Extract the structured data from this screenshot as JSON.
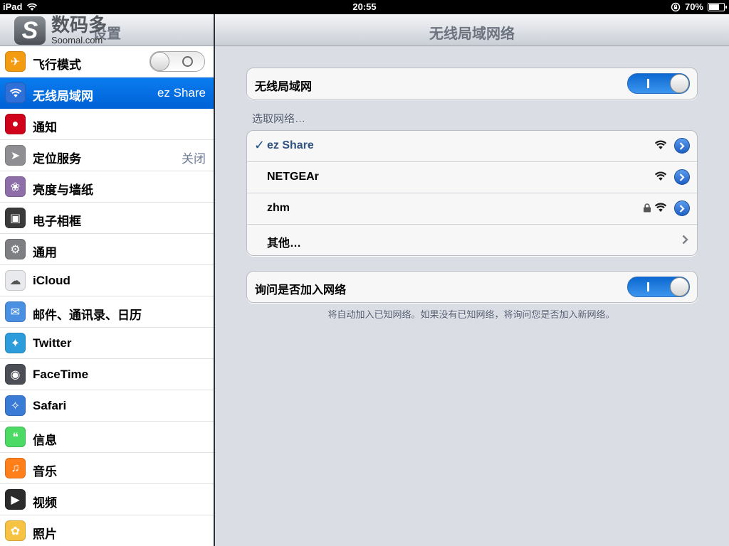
{
  "status_bar": {
    "device": "iPad",
    "time": "20:55",
    "battery": "70%",
    "battery_level": 0.7
  },
  "left_pane": {
    "title": "设置",
    "watermark": {
      "title": "数码多",
      "subtitle": "Soomal.com"
    },
    "items": [
      {
        "label": "飞行模式",
        "value": "",
        "icon": "airplane-icon",
        "color": "#f39c12",
        "toggle": "off"
      },
      {
        "label": "无线局域网",
        "value": "ez Share",
        "icon": "wifi-icon",
        "color": "#2f6fd8",
        "selected": true
      },
      {
        "label": "通知",
        "value": "",
        "icon": "notification-icon",
        "color": "#d0021b"
      },
      {
        "label": "定位服务",
        "value": "关闭",
        "icon": "location-icon",
        "color": "#8e8e93"
      },
      {
        "label": "亮度与墙纸",
        "value": "",
        "icon": "wallpaper-icon",
        "color": "#8d6ea8"
      },
      {
        "label": "电子相框",
        "value": "",
        "icon": "picture-frame-icon",
        "color": "#3a3a3a"
      },
      {
        "label": "通用",
        "value": "",
        "icon": "gear-icon",
        "color": "#7e7f82"
      },
      {
        "label": "iCloud",
        "value": "",
        "icon": "cloud-icon",
        "color": "#e8eaed"
      },
      {
        "label": "邮件、通讯录、日历",
        "value": "",
        "icon": "mail-icon",
        "color": "#4a90e2"
      },
      {
        "label": "Twitter",
        "value": "",
        "icon": "twitter-icon",
        "color": "#2d9cdb"
      },
      {
        "label": "FaceTime",
        "value": "",
        "icon": "facetime-icon",
        "color": "#4b4f55"
      },
      {
        "label": "Safari",
        "value": "",
        "icon": "safari-icon",
        "color": "#3a7bd5"
      },
      {
        "label": "信息",
        "value": "",
        "icon": "messages-icon",
        "color": "#4cd964"
      },
      {
        "label": "音乐",
        "value": "",
        "icon": "music-icon",
        "color": "#ff7f1a"
      },
      {
        "label": "视频",
        "value": "",
        "icon": "video-icon",
        "color": "#2b2b2b"
      },
      {
        "label": "照片",
        "value": "",
        "icon": "photos-icon",
        "color": "#f6c342"
      }
    ]
  },
  "right_pane": {
    "title": "无线局域网络",
    "wifi_toggle": {
      "label": "无线局域网",
      "state": "on"
    },
    "choose_network_title": "选取网络…",
    "networks": [
      {
        "name": "ez Share",
        "connected": true,
        "locked": false
      },
      {
        "name": "NETGEAr",
        "connected": false,
        "locked": false
      },
      {
        "name": "zhm",
        "connected": false,
        "locked": true
      }
    ],
    "other_label": "其他…",
    "ask_to_join": {
      "label": "询问是否加入网络",
      "state": "on"
    },
    "footer_note": "将自动加入已知网络。如果没有已知网络，将询问您是否加入新网络。",
    "accent_color": "#1f6fd6"
  }
}
